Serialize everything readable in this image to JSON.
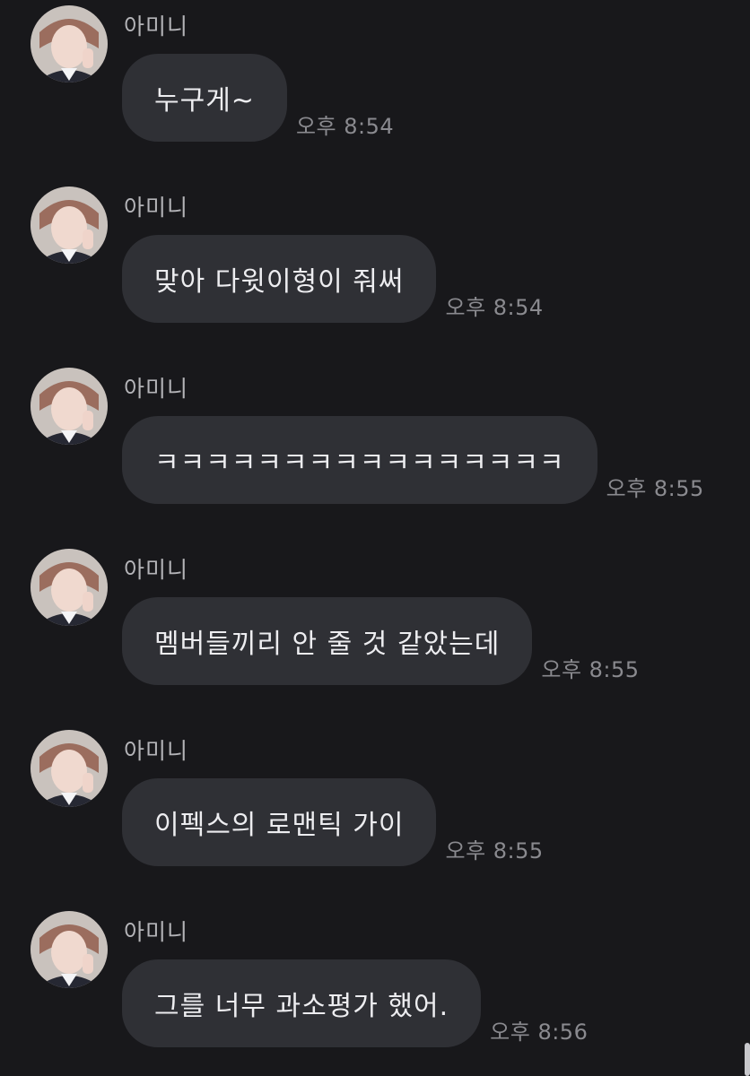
{
  "conversation": {
    "messages": [
      {
        "sender": "아미니",
        "text": "누구게~",
        "time": "오후 8:54"
      },
      {
        "sender": "아미니",
        "text": "맞아 다윗이형이 줘써",
        "time": "오후 8:54"
      },
      {
        "sender": "아미니",
        "text": "ㅋㅋㅋㅋㅋㅋㅋㅋㅋㅋㅋㅋㅋㅋㅋㅋ",
        "time": "오후 8:55"
      },
      {
        "sender": "아미니",
        "text": "멤버들끼리 안 줄 것 같았는데",
        "time": "오후 8:55"
      },
      {
        "sender": "아미니",
        "text": "이펙스의 로맨틱 가이",
        "time": "오후 8:55"
      },
      {
        "sender": "아미니",
        "text": "그를 너무 과소평가 했어.",
        "time": "오후 8:56"
      }
    ]
  },
  "theme": {
    "background": "#18181b",
    "bubble": "#2f3035",
    "bubble_text": "#ededf0",
    "sender_text": "#b4b4b8",
    "time_text": "#8a8a8f"
  }
}
